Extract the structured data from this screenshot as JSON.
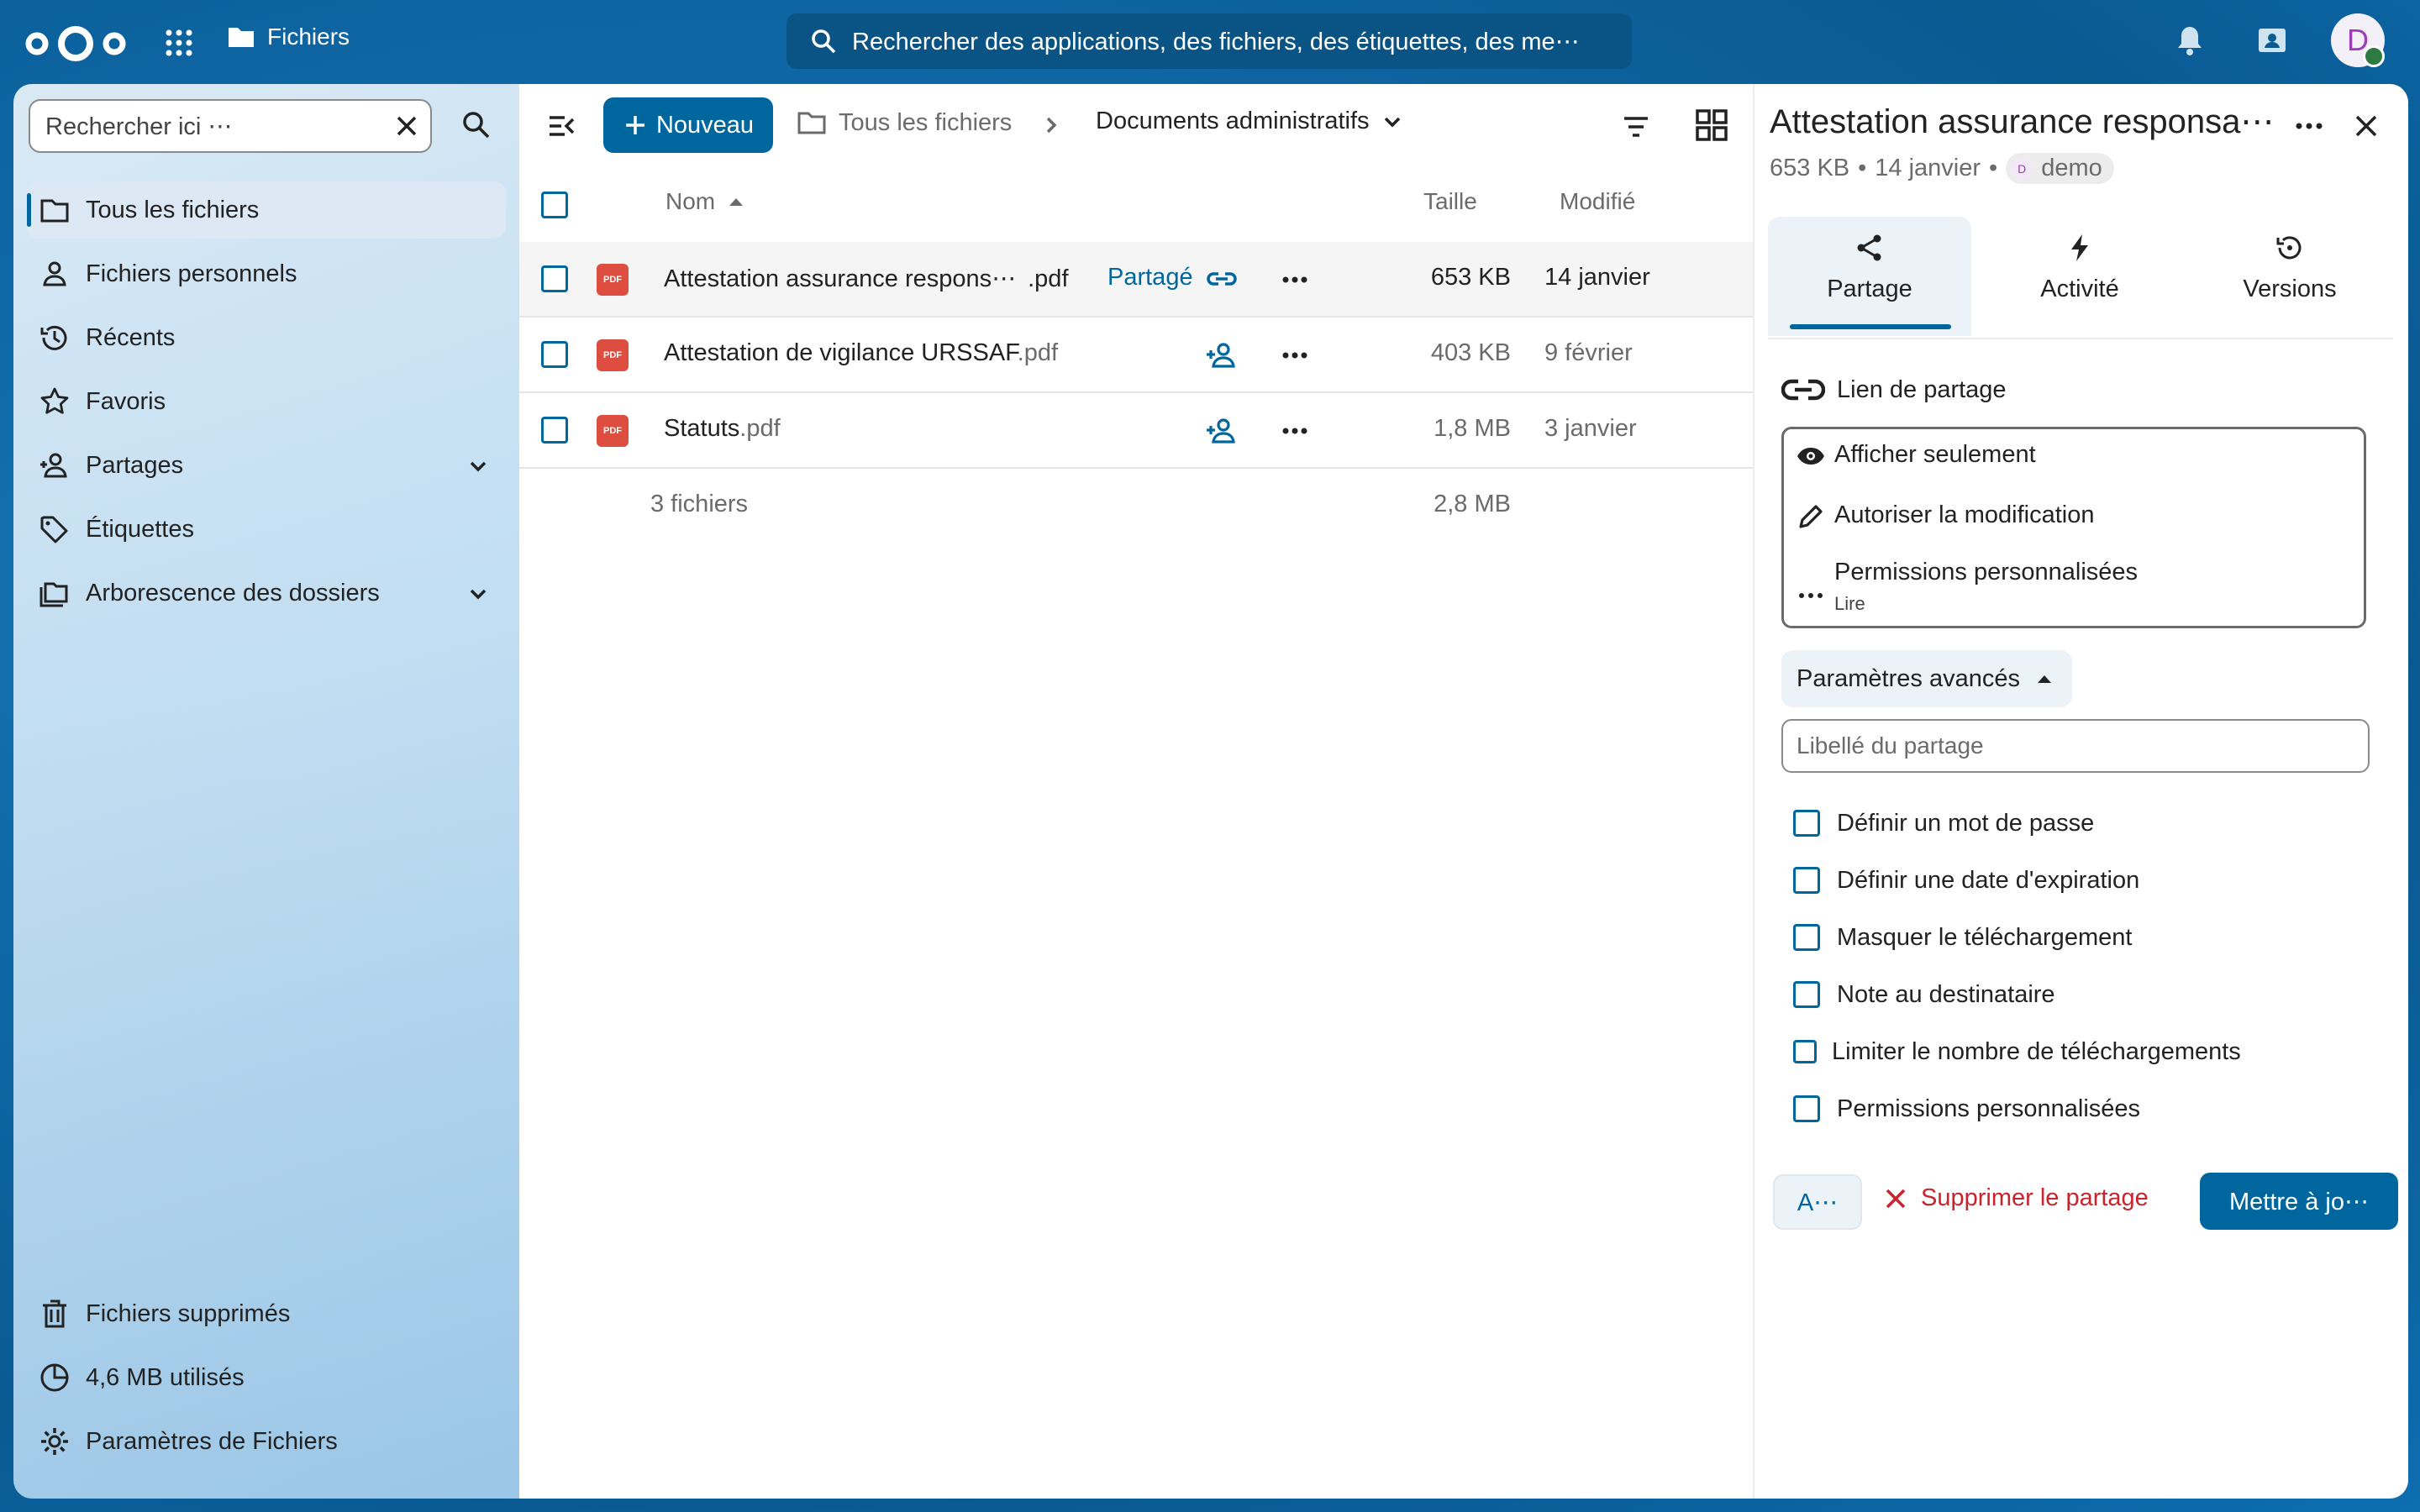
{
  "header": {
    "app_name": "Fichiers",
    "search_placeholder": "Rechercher des applications, des fichiers, des étiquettes, des me⋯",
    "avatar_letter": "D"
  },
  "sidebar": {
    "search_value": "Rechercher ici ⋯",
    "items": [
      {
        "label": "Tous les fichiers",
        "icon": "folder-icon",
        "active": true
      },
      {
        "label": "Fichiers personnels",
        "icon": "user-icon"
      },
      {
        "label": "Récents",
        "icon": "history-icon"
      },
      {
        "label": "Favoris",
        "icon": "star-icon"
      },
      {
        "label": "Partages",
        "icon": "share-user-icon",
        "expandable": true
      },
      {
        "label": "Étiquettes",
        "icon": "tag-icon"
      },
      {
        "label": "Arborescence des dossiers",
        "icon": "folder-tree-icon",
        "expandable": true
      }
    ],
    "bottom": {
      "trash": "Fichiers supprimés",
      "quota": "4,6 MB utilisés",
      "settings": "Paramètres de Fichiers"
    }
  },
  "toolbar": {
    "new_label": "Nouveau",
    "crumb_root": "Tous les fichiers",
    "crumb_current": "Documents administratifs"
  },
  "table": {
    "columns": {
      "name": "Nom",
      "size": "Taille",
      "modified": "Modifié"
    },
    "rows": [
      {
        "name": "Attestation assurance respons⋯",
        "ext": ".pdf",
        "shared_label": "Partagé",
        "size": "653 KB",
        "modified": "14 janvier"
      },
      {
        "name": "Attestation de vigilance URSSAF",
        "ext": ".pdf",
        "shared_label": "",
        "size": "403 KB",
        "modified": "9 février"
      },
      {
        "name": "Statuts",
        "ext": ".pdf",
        "shared_label": "",
        "size": "1,8 MB",
        "modified": "3 janvier"
      }
    ],
    "summary": {
      "count": "3 fichiers",
      "total": "2,8 MB"
    }
  },
  "panel": {
    "title": "Attestation assurance responsa⋯",
    "size": "653 KB",
    "date": "14 janvier",
    "user": "demo",
    "user_initial": "D",
    "tabs": [
      "Partage",
      "Activité",
      "Versions"
    ],
    "link_title": "Lien de partage",
    "permissions": [
      {
        "label": "Afficher seulement",
        "icon": "eye-icon"
      },
      {
        "label": "Autoriser la modification",
        "icon": "pencil-icon"
      },
      {
        "label": "Permissions personnalisées",
        "sub": "Lire",
        "icon": "dots-icon"
      }
    ],
    "advanced": "Paramètres avancés",
    "label_placeholder": "Libellé du partage",
    "options": [
      "Définir un mot de passe",
      "Définir une date d'expiration",
      "Masquer le téléchargement",
      "Note au destinataire",
      "Limiter le nombre de téléchargements",
      "Permissions personnalisées"
    ],
    "footer": {
      "a": "A⋯",
      "delete": "Supprimer le partage",
      "update": "Mettre à jo⋯"
    }
  },
  "colors": {
    "primary": "#00679e",
    "danger": "#c9232e",
    "pdf": "#dd4e40"
  }
}
